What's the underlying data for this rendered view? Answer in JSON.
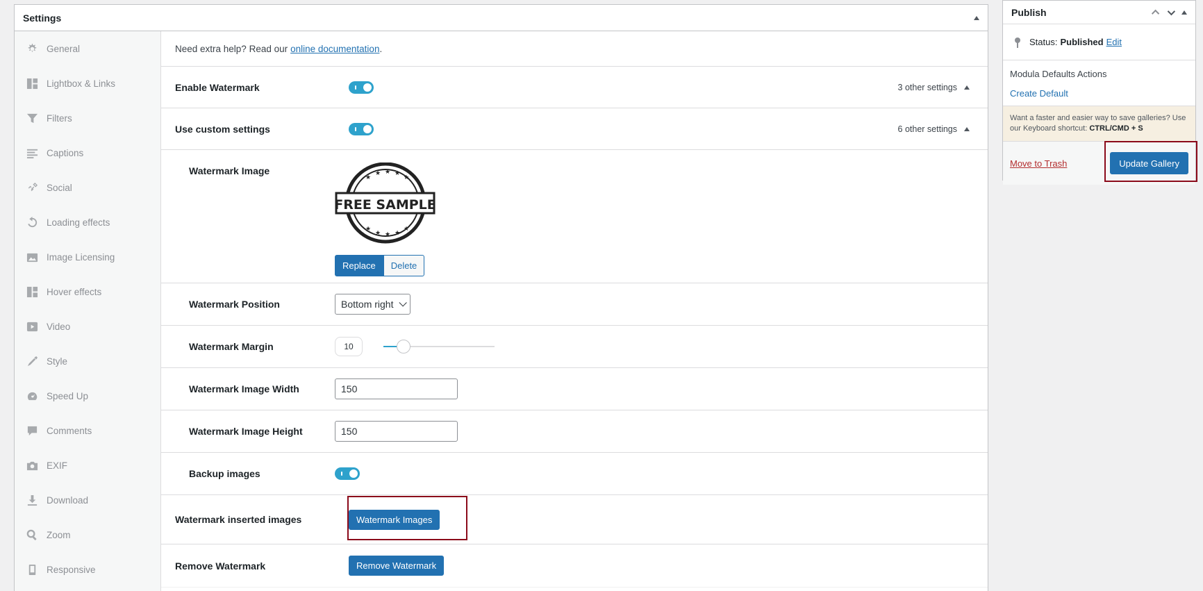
{
  "settings": {
    "title": "Settings",
    "tabs": [
      {
        "label": "General",
        "icon": "gear-icon"
      },
      {
        "label": "Lightbox & Links",
        "icon": "grid-icon"
      },
      {
        "label": "Filters",
        "icon": "filter-icon"
      },
      {
        "label": "Captions",
        "icon": "captions-icon"
      },
      {
        "label": "Social",
        "icon": "link-icon"
      },
      {
        "label": "Loading effects",
        "icon": "refresh-icon"
      },
      {
        "label": "Image Licensing",
        "icon": "image-icon"
      },
      {
        "label": "Hover effects",
        "icon": "grid-icon"
      },
      {
        "label": "Video",
        "icon": "video-icon"
      },
      {
        "label": "Style",
        "icon": "brush-icon"
      },
      {
        "label": "Speed Up",
        "icon": "dashboard-icon"
      },
      {
        "label": "Comments",
        "icon": "comment-icon"
      },
      {
        "label": "EXIF",
        "icon": "camera-icon"
      },
      {
        "label": "Download",
        "icon": "download-icon"
      },
      {
        "label": "Zoom",
        "icon": "search-icon"
      },
      {
        "label": "Responsive",
        "icon": "phone-icon"
      }
    ],
    "help_text": "Need extra help? Read our",
    "help_link": "online documentation",
    "help_end": ".",
    "enable_watermark": {
      "label": "Enable Watermark",
      "other": "3 other settings",
      "enabled": true
    },
    "use_custom": {
      "label": "Use custom settings",
      "other": "6 other settings",
      "enabled": true
    },
    "watermark_image": {
      "label": "Watermark Image",
      "stamp_text": "FREE SAMPLE",
      "replace": "Replace",
      "delete": "Delete"
    },
    "watermark_position": {
      "label": "Watermark Position",
      "value": "Bottom right"
    },
    "watermark_margin": {
      "label": "Watermark Margin",
      "value": "10",
      "slider_fraction": 0.18
    },
    "watermark_width": {
      "label": "Watermark Image Width",
      "value": "150"
    },
    "watermark_height": {
      "label": "Watermark Image Height",
      "value": "150"
    },
    "backup_images": {
      "label": "Backup images",
      "enabled": true
    },
    "watermark_inserted": {
      "label": "Watermark inserted images",
      "button": "Watermark Images"
    },
    "remove_watermark": {
      "label": "Remove Watermark",
      "button": "Remove Watermark"
    }
  },
  "publish": {
    "title": "Publish",
    "status_label": "Status:",
    "status_value": "Published",
    "status_edit": "Edit",
    "defaults_title": "Modula Defaults Actions",
    "create_default": "Create Default",
    "tip_text": "Want a faster and easier way to save galleries? Use our Keyboard shortcut:",
    "tip_shortcut": "CTRL/CMD + S",
    "move_to_trash": "Move to Trash",
    "update_button": "Update Gallery"
  },
  "colors": {
    "accent": "#2271b1",
    "toggle": "#2ea2cc",
    "highlight": "#8b0a1a",
    "trash": "#b32d2e"
  }
}
